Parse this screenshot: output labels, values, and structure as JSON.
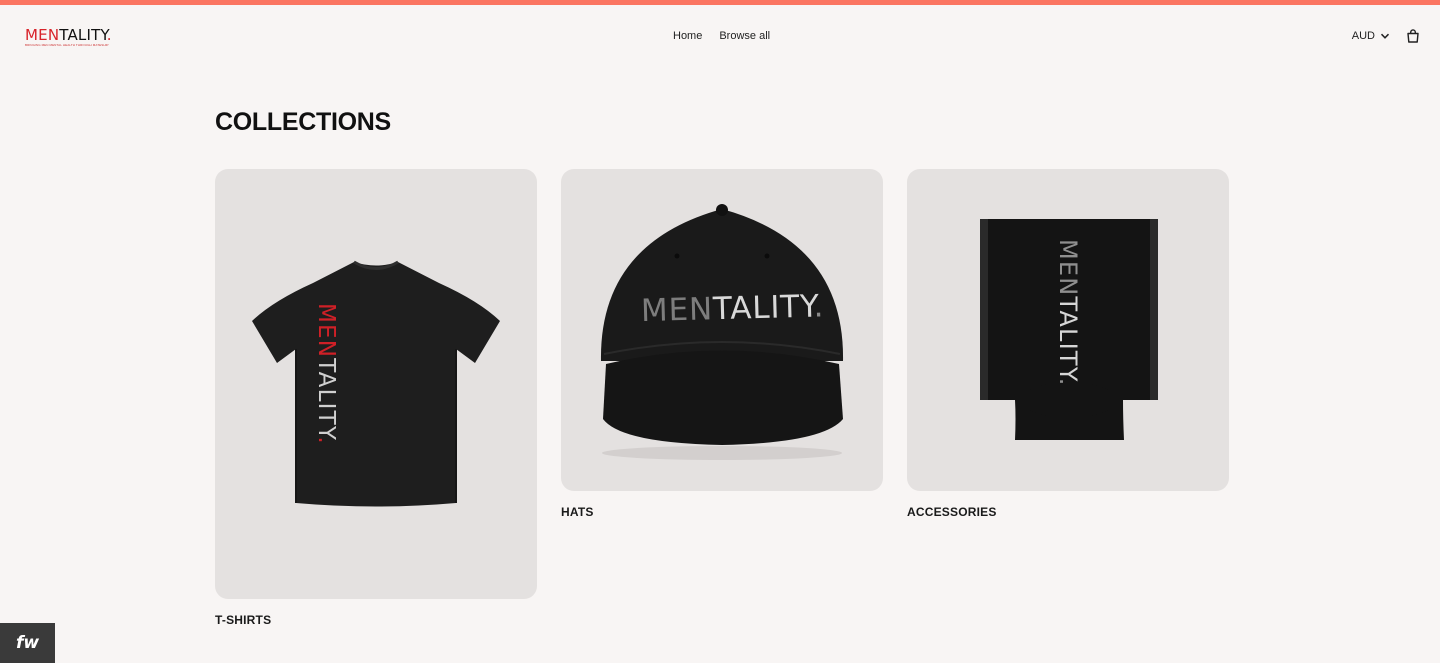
{
  "brand": {
    "logo_men": "MEN",
    "logo_rest": "TALITY",
    "logo_dot": ".",
    "tagline": "BRINGING MEN MENTAL HEALTH THROUGH MATESHIP"
  },
  "nav": {
    "items": [
      {
        "label": "Home"
      },
      {
        "label": "Browse all"
      }
    ]
  },
  "header_tools": {
    "currency": "AUD",
    "icons": [
      "chevron-down-icon",
      "shopping-bag-icon"
    ]
  },
  "page": {
    "title": "COLLECTIONS"
  },
  "collections": [
    {
      "label": "T-SHIRTS",
      "image": "t-shirt-image",
      "print": "MENTALITY."
    },
    {
      "label": "HATS",
      "image": "hat-image",
      "print": "MENTALITY."
    },
    {
      "label": "ACCESSORIES",
      "image": "stubby-holder-image",
      "print": "MENTALITY."
    }
  ],
  "badge": {
    "text": "fw"
  },
  "colors": {
    "accent_bar": "#fb7561",
    "brand_red": "#d8232a",
    "background": "#f8f5f4",
    "card_bg": "#e4e1e0"
  }
}
